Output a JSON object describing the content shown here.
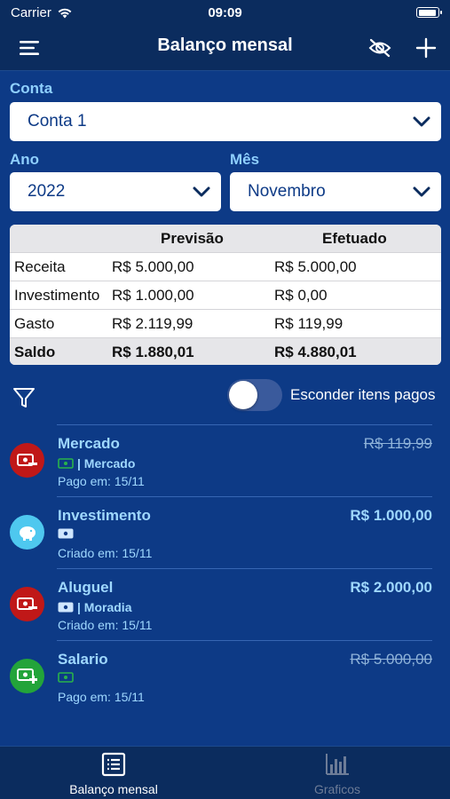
{
  "status_bar": {
    "carrier": "Carrier",
    "time": "09:09"
  },
  "nav": {
    "title": "Balanço mensal"
  },
  "filters": {
    "account_label": "Conta",
    "account_value": "Conta 1",
    "year_label": "Ano",
    "year_value": "2022",
    "month_label": "Mês",
    "month_value": "Novembro"
  },
  "summary": {
    "headers": [
      "",
      "Previsão",
      "Efetuado"
    ],
    "rows": [
      {
        "label": "Receita",
        "forecast": "R$ 5.000,00",
        "done": "R$ 5.000,00"
      },
      {
        "label": "Investimento",
        "forecast": "R$ 1.000,00",
        "done": "R$ 0,00"
      },
      {
        "label": "Gasto",
        "forecast": "R$ 2.119,99",
        "done": "R$ 119,99"
      },
      {
        "label": "Saldo",
        "forecast": "R$ 1.880,01",
        "done": "R$ 4.880,01"
      }
    ]
  },
  "hide_paid": {
    "label": "Esconder itens pagos",
    "enabled": false
  },
  "items": [
    {
      "title": "Mercado",
      "category": "| Mercado",
      "status": "Pago em: 15/11",
      "amount": "R$ 119,99",
      "paid": true,
      "avatar_color": "#c01818",
      "icon": "expense-icon"
    },
    {
      "title": "Investimento",
      "category": "",
      "status": "Criado em: 15/11",
      "amount": "R$ 1.000,00",
      "paid": false,
      "avatar_color": "#4ec8ef",
      "icon": "piggy-bank-icon"
    },
    {
      "title": "Aluguel",
      "category": "| Moradia",
      "status": "Criado em: 15/11",
      "amount": "R$ 2.000,00",
      "paid": false,
      "avatar_color": "#c01818",
      "icon": "expense-icon"
    },
    {
      "title": "Salario",
      "category": "",
      "status": "Pago em: 15/11",
      "amount": "R$ 5.000,00",
      "paid": true,
      "avatar_color": "#23a43a",
      "icon": "income-icon"
    }
  ],
  "tabs": [
    {
      "label": "Balanço mensal",
      "active": true,
      "icon": "list-icon"
    },
    {
      "label": "Graficos",
      "active": false,
      "icon": "bar-chart-icon"
    }
  ],
  "colors": {
    "background": "#0d3a86",
    "bar": "#0b2c5e",
    "accent_text": "#9fd8ff",
    "expense": "#c01818",
    "income": "#23a43a",
    "investment": "#4ec8ef"
  }
}
